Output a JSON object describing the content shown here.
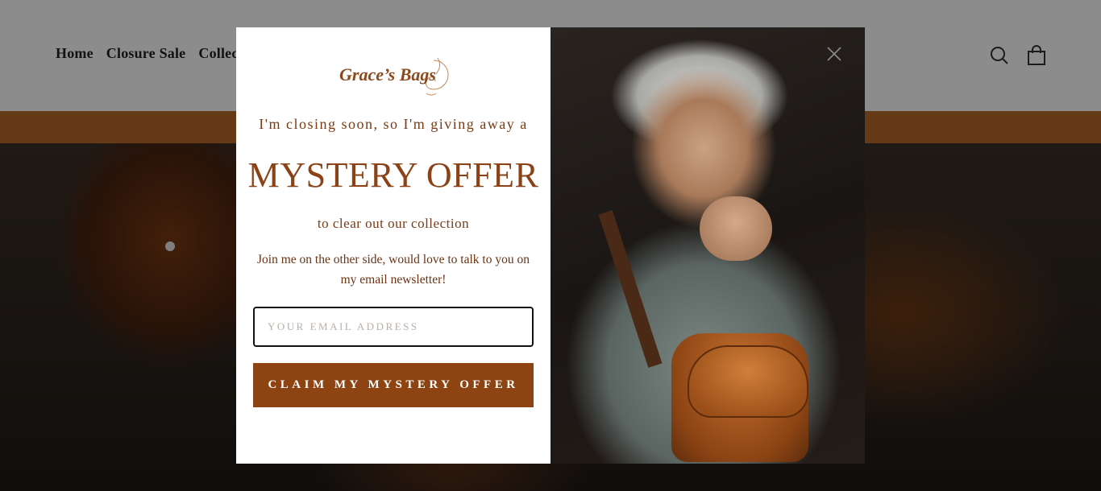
{
  "header": {
    "nav": [
      {
        "label": "Home"
      },
      {
        "label": "Closure Sale"
      },
      {
        "label": "Collect"
      }
    ],
    "icons": [
      "search-icon",
      "cart-icon"
    ]
  },
  "popup": {
    "logo_text": "Grace’s Bags",
    "lead": "I'm closing soon, so I'm giving away a",
    "headline": "MYSTERY OFFER",
    "sub": "to clear out our collection",
    "body": "Join me on the other side, would love to talk to you on my email newsletter!",
    "email_placeholder": "YOUR EMAIL ADDRESS",
    "email_value": "",
    "cta_label": "CLAIM MY MYSTERY OFFER",
    "close_icon": "close-icon"
  },
  "colors": {
    "brand_brown": "#8d4312",
    "announce_bar": "#b86a28",
    "text_brown": "#7a3a14"
  }
}
